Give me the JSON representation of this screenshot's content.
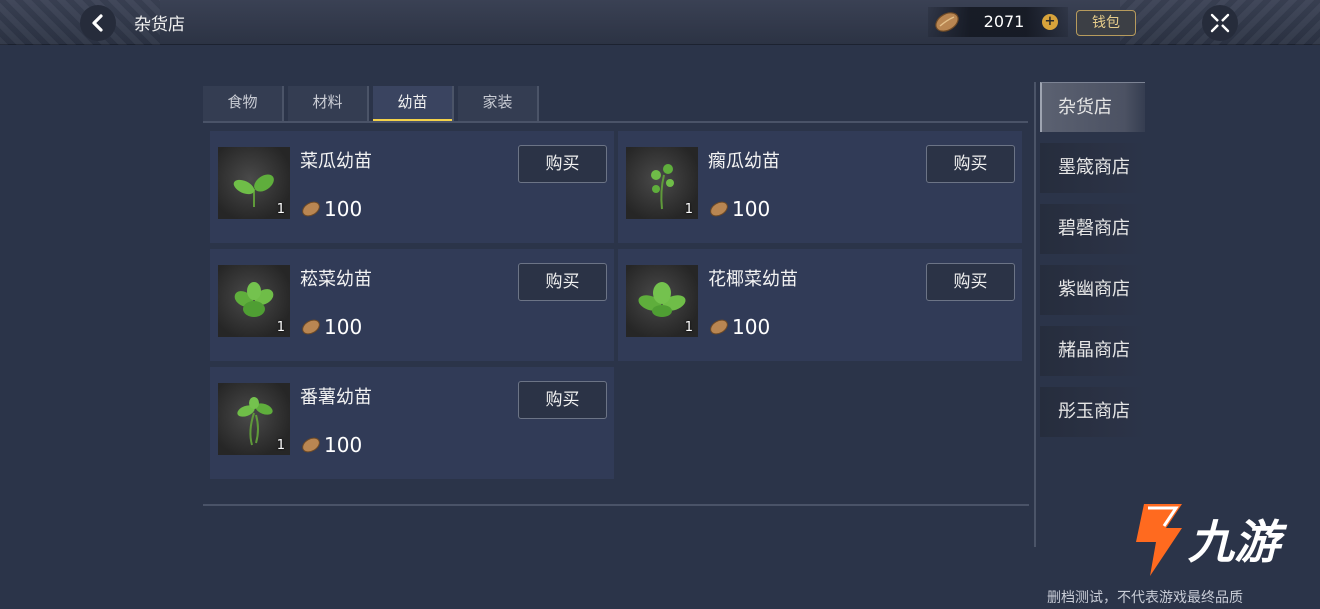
{
  "header": {
    "title": "杂货店",
    "currency_amount": "2071",
    "wallet_label": "钱包"
  },
  "tabs": [
    {
      "label": "食物",
      "active": false
    },
    {
      "label": "材料",
      "active": false
    },
    {
      "label": "幼苗",
      "active": true
    },
    {
      "label": "家装",
      "active": false
    }
  ],
  "items": [
    {
      "name": "菜瓜幼苗",
      "qty": "1",
      "price": "100",
      "buy_label": "购买",
      "icon": "sprout-broadleaf-icon"
    },
    {
      "name": "瘸瓜幼苗",
      "qty": "1",
      "price": "100",
      "buy_label": "购买",
      "icon": "sprout-vine-icon"
    },
    {
      "name": "菘菜幼苗",
      "qty": "1",
      "price": "100",
      "buy_label": "购买",
      "icon": "sprout-cabbage-icon"
    },
    {
      "name": "花椰菜幼苗",
      "qty": "1",
      "price": "100",
      "buy_label": "购买",
      "icon": "sprout-cauliflower-icon"
    },
    {
      "name": "番薯幼苗",
      "qty": "1",
      "price": "100",
      "buy_label": "购买",
      "icon": "sprout-sweetpotato-icon"
    }
  ],
  "shops": [
    {
      "label": "杂货店",
      "active": true
    },
    {
      "label": "墨箴商店",
      "active": false
    },
    {
      "label": "碧磬商店",
      "active": false
    },
    {
      "label": "紫幽商店",
      "active": false
    },
    {
      "label": "赭晶商店",
      "active": false
    },
    {
      "label": "彤玉商店",
      "active": false
    }
  ],
  "watermark": {
    "brand": "九游",
    "note": "删档测试，不代表游戏最终品质"
  },
  "colors": {
    "background": "#2b3449",
    "card": "#313b57",
    "tab_active_underline": "#f4d24a",
    "coin": "#b98652",
    "logo_orange": "#ff6a1f"
  }
}
